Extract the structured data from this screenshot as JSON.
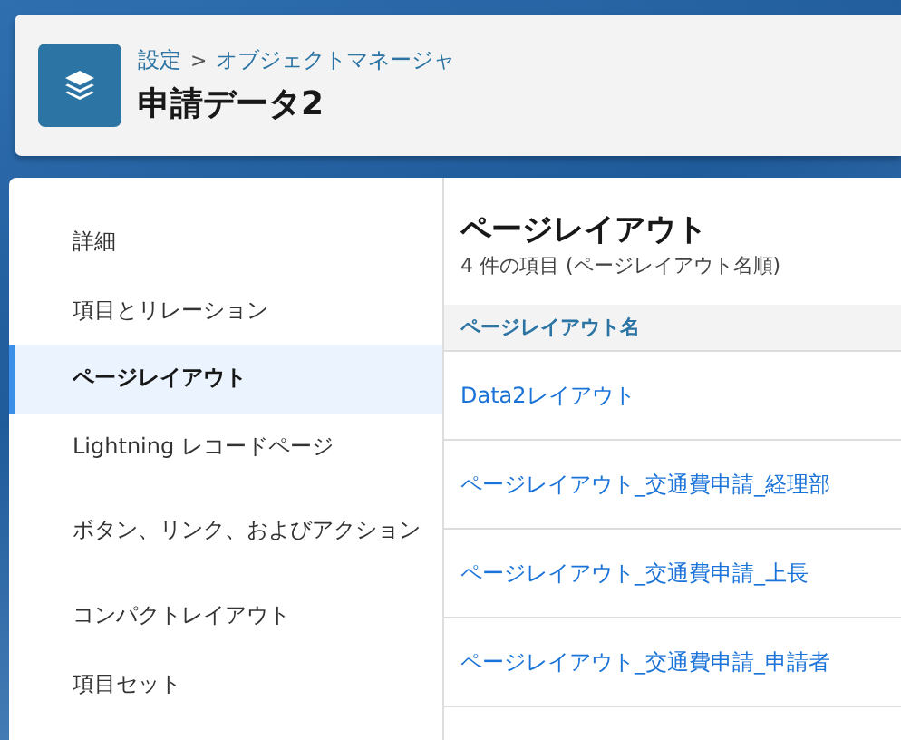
{
  "header": {
    "breadcrumb": [
      {
        "label": "設定"
      },
      {
        "label": "オブジェクトマネージャ"
      }
    ],
    "separator": ">",
    "title": "申請データ2"
  },
  "sidebar": {
    "items": [
      {
        "label": "詳細",
        "selected": false
      },
      {
        "label": "項目とリレーション",
        "selected": false
      },
      {
        "label": "ページレイアウト",
        "selected": true
      },
      {
        "label": "Lightning レコードページ",
        "selected": false
      },
      {
        "label": "ボタン、リンク、およびアクション",
        "selected": false
      },
      {
        "label": "コンパクトレイアウト",
        "selected": false
      },
      {
        "label": "項目セット",
        "selected": false
      }
    ]
  },
  "content": {
    "title": "ページレイアウト",
    "subtitle": "4 件の項目 (ページレイアウト名順)",
    "table": {
      "columns": [
        "ページレイアウト名"
      ],
      "rows": [
        [
          "Data2レイアウト"
        ],
        [
          "ページレイアウト_交通費申請_経理部"
        ],
        [
          "ページレイアウト_交通費申請_上長"
        ],
        [
          "ページレイアウト_交通費申請_申請者"
        ]
      ]
    }
  }
}
